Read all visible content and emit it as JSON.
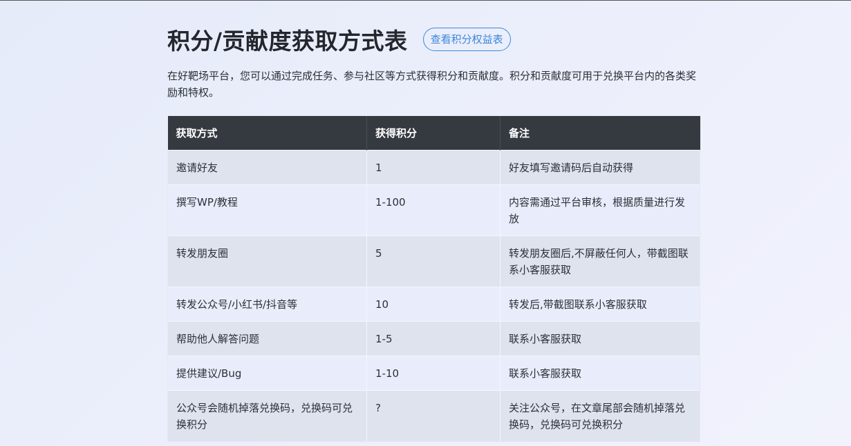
{
  "page": {
    "title": "积分/贡献度获取方式表",
    "rights_button_label": "查看积分权益表",
    "intro": "在好靶场平台，您可以通过完成任务、参与社区等方式获得积分和贡献度。积分和贡献度可用于兑换平台内的各类奖励和特权。"
  },
  "table": {
    "headers": [
      "获取方式",
      "获得积分",
      "备注"
    ],
    "rows": [
      {
        "method": "邀请好友",
        "points": "1",
        "note": "好友填写邀请码后自动获得"
      },
      {
        "method": "撰写WP/教程",
        "points": "1-100",
        "note": "内容需通过平台审核，根据质量进行发放"
      },
      {
        "method": "转发朋友圈",
        "points": "5",
        "note": "转发朋友圈后,不屏蔽任何人，带截图联系小客服获取"
      },
      {
        "method": "转发公众号/小红书/抖音等",
        "points": "10",
        "note": "转发后,带截图联系小客服获取"
      },
      {
        "method": "帮助他人解答问题",
        "points": "1-5",
        "note": "联系小客服获取"
      },
      {
        "method": "提供建议/Bug",
        "points": "1-10",
        "note": "联系小客服获取"
      },
      {
        "method": "公众号会随机掉落兑换码，兑换码可兑换积分",
        "points": "?",
        "note": "关注公众号，在文章尾部会随机掉落兑换码，兑换码可兑换积分"
      }
    ]
  },
  "colors": {
    "accent": "#3a89d8",
    "header_bg": "#353a41",
    "row_odd": "#dfe3ee",
    "row_even": "#e9edfb"
  }
}
